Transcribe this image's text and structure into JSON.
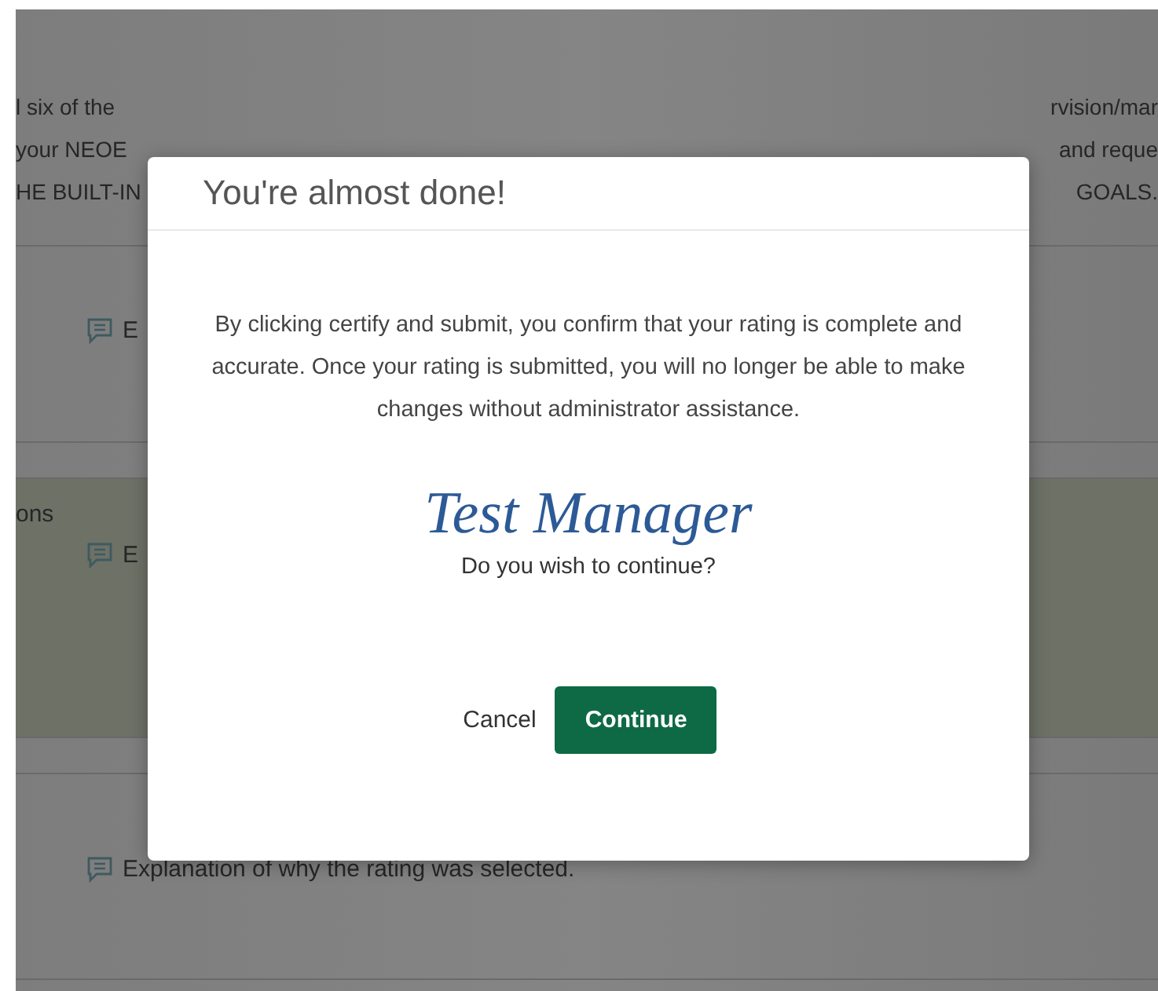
{
  "background": {
    "intro_lines": [
      {
        "left": "l six of the",
        "right": "rvision/mar"
      },
      {
        "left": "your NEOE",
        "right": "and reque"
      },
      {
        "left": "HE BUILT-IN",
        "right": "GOALS."
      }
    ],
    "rows": [
      {
        "heading": "",
        "explanation": "E",
        "highlighted": false
      },
      {
        "heading": "ons",
        "explanation": "E",
        "highlighted": true
      },
      {
        "heading": "",
        "explanation": "Explanation of why the rating was selected.",
        "highlighted": false
      }
    ]
  },
  "modal": {
    "title": "You're almost done!",
    "message": "By clicking certify and submit, you confirm that your rating is complete and accurate. Once your rating is submitted, you will no longer be able to make changes without administrator assistance.",
    "signature": "Test Manager",
    "prompt": "Do you wish to continue?",
    "buttons": [
      {
        "label": "Cancel",
        "kind": "link"
      },
      {
        "label": "Continue",
        "kind": "primary"
      }
    ]
  }
}
